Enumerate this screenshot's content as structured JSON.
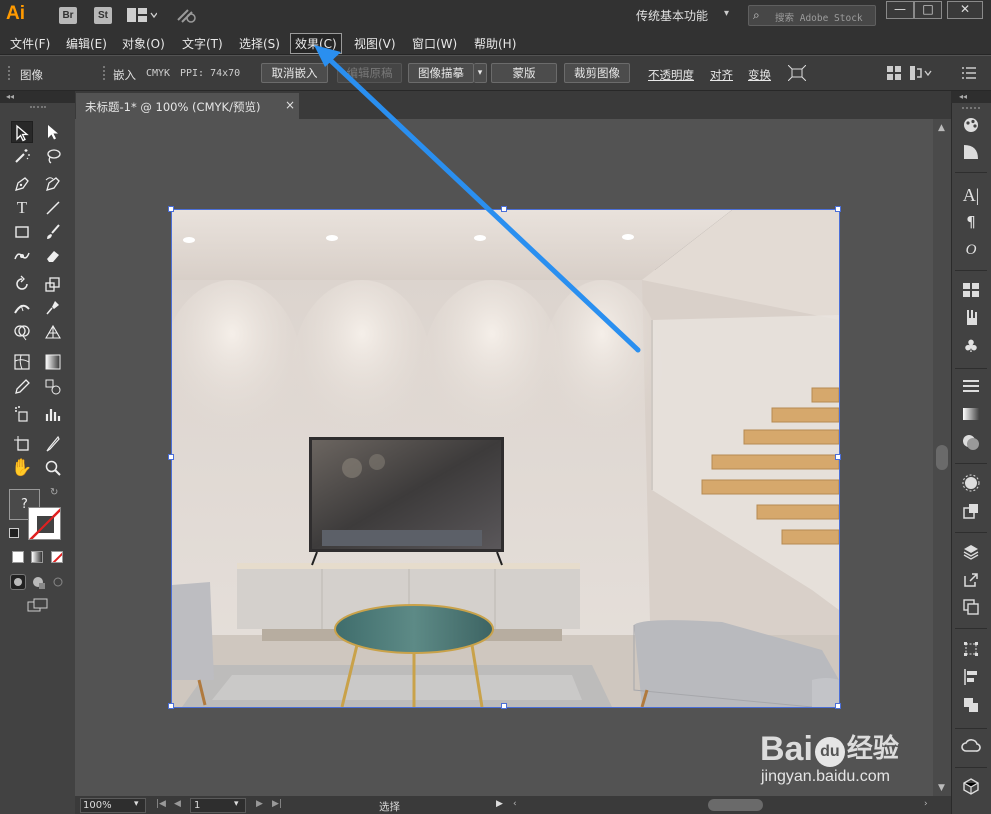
{
  "app": {
    "logo": "Ai",
    "badges": [
      "Br",
      "St"
    ],
    "workspace": "传统基本功能",
    "stock_search_placeholder": "搜索 Adobe Stock",
    "window_buttons": [
      "—",
      "□",
      "✕"
    ]
  },
  "menu": {
    "items": [
      "文件(F)",
      "编辑(E)",
      "对象(O)",
      "文字(T)",
      "选择(S)",
      "效果(C)",
      "视图(V)",
      "窗口(W)",
      "帮助(H)"
    ],
    "active": "效果(C)"
  },
  "control_bar": {
    "object_type": "图像",
    "embed_label": "嵌入",
    "color_mode": "CMYK",
    "ppi": "PPI: 74x70",
    "unembed_button": "取消嵌入",
    "edit_original_button": "编辑原稿",
    "image_trace_button": "图像描摹",
    "mask_button": "蒙版",
    "crop_button": "裁剪图像",
    "opacity_link": "不透明度",
    "align_link": "对齐",
    "transform_link": "变换"
  },
  "document": {
    "tab_title": "未标题-1* @ 100% (CMYK/预览)",
    "close_glyph": "×"
  },
  "status_bar": {
    "zoom": "100%",
    "page": "1",
    "tool_status": "选择"
  },
  "tools": {
    "fill_stroke_question": "?"
  },
  "accent": {
    "selection": "#4b6fd8",
    "annotation_arrow": "#2a8ff0",
    "ai_logo": "#ff9a00"
  },
  "watermark": {
    "brand": "Bai",
    "brand_cn": "经验",
    "url": "jingyan.baidu.com"
  }
}
